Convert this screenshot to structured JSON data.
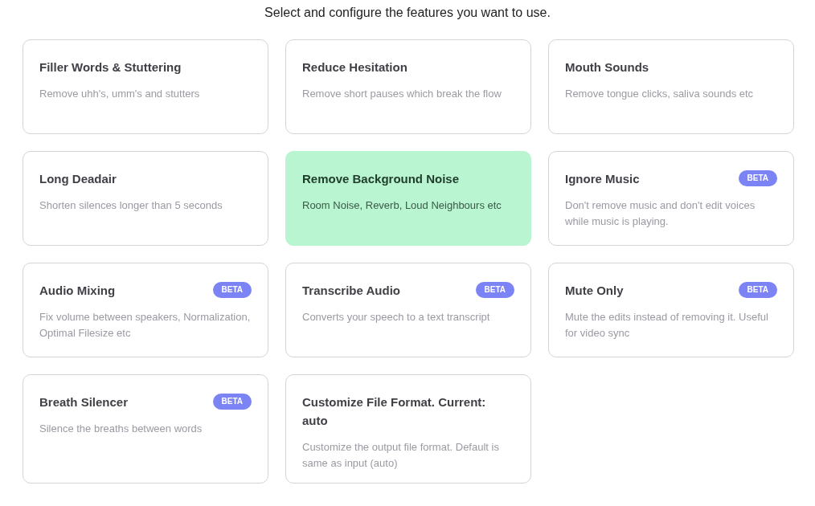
{
  "heading": "Select and configure the features you want to use.",
  "features": [
    {
      "title": "Filler Words & Stuttering",
      "description": "Remove uhh's, umm's and stutters",
      "selected": false
    },
    {
      "title": "Reduce Hesitation",
      "description": "Remove short pauses which break the flow",
      "selected": false
    },
    {
      "title": "Mouth Sounds",
      "description": "Remove tongue clicks, saliva sounds etc",
      "selected": false
    },
    {
      "title": "Long Deadair",
      "description": "Shorten silences longer than 5 seconds",
      "selected": false
    },
    {
      "title": "Remove Background Noise",
      "description": "Room Noise, Reverb, Loud Neighbours etc",
      "selected": true
    },
    {
      "title": "Ignore Music",
      "badge": "BETA",
      "description": "Don't remove music and don't edit voices while music is playing.",
      "selected": false
    },
    {
      "title": "Audio Mixing",
      "badge": "BETA",
      "description": "Fix volume between speakers, Normalization, Optimal Filesize etc",
      "selected": false
    },
    {
      "title": "Transcribe Audio",
      "badge": "BETA",
      "description": "Converts your speech to a text transcript",
      "selected": false
    },
    {
      "title": "Mute Only",
      "badge": "BETA",
      "description": "Mute the edits instead of removing it. Useful for video sync",
      "selected": false
    },
    {
      "title": "Breath Silencer",
      "badge": "BETA",
      "description": "Silence the breaths between words",
      "selected": false
    },
    {
      "title": "Customize File Format. Current: auto",
      "description": "Customize the output file format. Default is same as input (auto)",
      "selected": false
    }
  ]
}
